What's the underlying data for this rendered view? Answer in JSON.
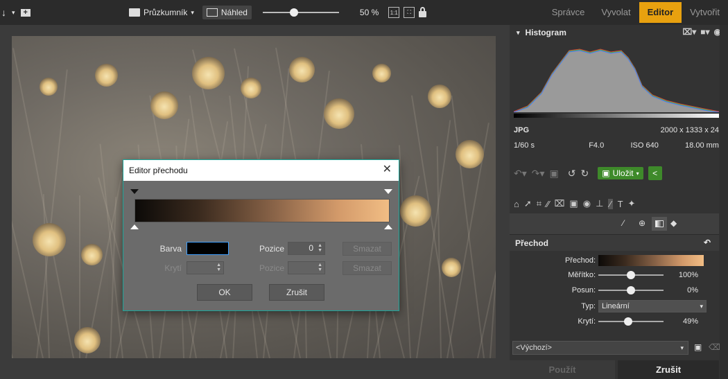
{
  "toolbar": {
    "explorer_label": "Průzkumník",
    "preview_label": "Náhled",
    "zoom_label": "50 %",
    "zoom_level": 0.4,
    "actual_size_label": "1:1"
  },
  "tabs": [
    {
      "label": "Správce",
      "active": false
    },
    {
      "label": "Vyvolat",
      "active": false
    },
    {
      "label": "Editor",
      "active": true
    },
    {
      "label": "Vytvořit",
      "active": false
    }
  ],
  "dialog": {
    "title": "Editor přechodu",
    "color_label": "Barva",
    "position_label": "Pozice",
    "position_value": "0",
    "delete_label": "Smazat",
    "opacity_label": "Krytí",
    "position2_label": "Pozice",
    "delete2_label": "Smazat",
    "ok_label": "OK",
    "cancel_label": "Zrušit"
  },
  "panel": {
    "histogram_title": "Histogram",
    "format": "JPG",
    "dimensions": "2000 x 1333 x 24",
    "shutter": "1/60 s",
    "aperture": "F4.0",
    "iso": "ISO 640",
    "focal": "18.00 mm",
    "save_label": "Uložit",
    "section_title": "Přechod",
    "props": {
      "gradient_label": "Přechod:",
      "scale_label": "Měřítko:",
      "scale_value": "100%",
      "scale_level": 0.5,
      "shift_label": "Posun:",
      "shift_value": "0%",
      "shift_level": 0.5,
      "type_label": "Typ:",
      "type_value": "Lineární",
      "opacity_label": "Krytí:",
      "opacity_value": "49%",
      "opacity_level": 0.45
    },
    "preset_value": "<Výchozí>",
    "apply_label": "Použít",
    "cancel_label": "Zrušit"
  },
  "colors": {
    "accent": "#e8a10f",
    "save_green": "#3e8a2a",
    "dialog_border": "#1aa69a"
  }
}
